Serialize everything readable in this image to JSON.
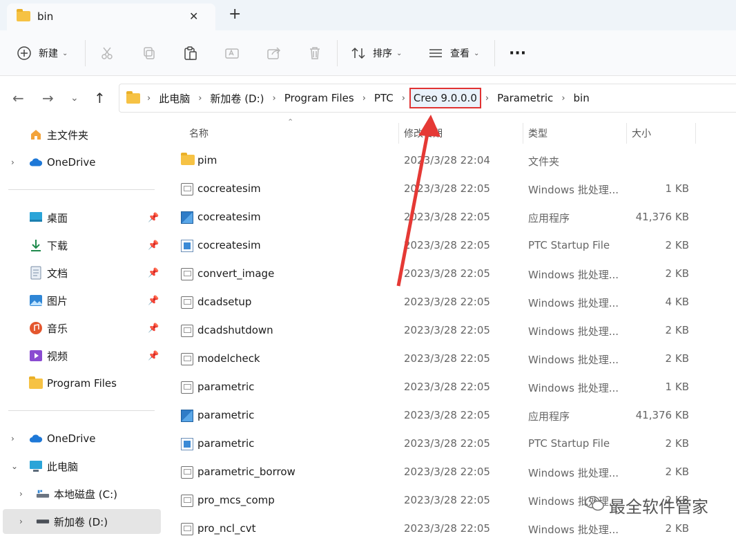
{
  "tab": {
    "title": "bin",
    "close_icon": "close-icon",
    "new_tab": "+"
  },
  "toolbar": {
    "new_label": "新建",
    "sort_label": "排序",
    "view_label": "查看",
    "more_label": "···"
  },
  "breadcrumb": [
    "此电脑",
    "新加卷 (D:)",
    "Program Files",
    "PTC",
    "Creo 9.0.0.0",
    "Parametric",
    "bin"
  ],
  "sidebar": {
    "top": [
      {
        "label": "主文件夹",
        "icon": "home-icon"
      },
      {
        "label": "OneDrive",
        "icon": "cloud-icon"
      }
    ],
    "quick": [
      {
        "label": "桌面",
        "icon": "desktop-icon"
      },
      {
        "label": "下载",
        "icon": "download-icon"
      },
      {
        "label": "文档",
        "icon": "document-icon"
      },
      {
        "label": "图片",
        "icon": "pictures-icon"
      },
      {
        "label": "音乐",
        "icon": "music-icon"
      },
      {
        "label": "视频",
        "icon": "video-icon"
      },
      {
        "label": "Program Files",
        "icon": "folder-icon"
      }
    ],
    "bottom": [
      {
        "label": "OneDrive",
        "icon": "cloud-icon"
      },
      {
        "label": "此电脑",
        "icon": "computer-icon"
      },
      {
        "label": "本地磁盘 (C:)",
        "icon": "drive-icon"
      },
      {
        "label": "新加卷 (D:)",
        "icon": "drive-icon"
      }
    ]
  },
  "columns": {
    "name": "名称",
    "date": "修改日期",
    "type": "类型",
    "size": "大小"
  },
  "files": [
    {
      "name": "pim",
      "date": "2023/3/28 22:04",
      "type": "文件夹",
      "size": "",
      "kind": "folder"
    },
    {
      "name": "cocreatesim",
      "date": "2023/3/28 22:05",
      "type": "Windows 批处理...",
      "size": "1 KB",
      "kind": "bat"
    },
    {
      "name": "cocreatesim",
      "date": "2023/3/28 22:05",
      "type": "应用程序",
      "size": "41,376 KB",
      "kind": "exe"
    },
    {
      "name": "cocreatesim",
      "date": "2023/3/28 22:05",
      "type": "PTC Startup File",
      "size": "2 KB",
      "kind": "ptc"
    },
    {
      "name": "convert_image",
      "date": "2023/3/28 22:05",
      "type": "Windows 批处理...",
      "size": "2 KB",
      "kind": "bat"
    },
    {
      "name": "dcadsetup",
      "date": "2023/3/28 22:05",
      "type": "Windows 批处理...",
      "size": "4 KB",
      "kind": "bat"
    },
    {
      "name": "dcadshutdown",
      "date": "2023/3/28 22:05",
      "type": "Windows 批处理...",
      "size": "2 KB",
      "kind": "bat"
    },
    {
      "name": "modelcheck",
      "date": "2023/3/28 22:05",
      "type": "Windows 批处理...",
      "size": "2 KB",
      "kind": "bat"
    },
    {
      "name": "parametric",
      "date": "2023/3/28 22:05",
      "type": "Windows 批处理...",
      "size": "1 KB",
      "kind": "bat"
    },
    {
      "name": "parametric",
      "date": "2023/3/28 22:05",
      "type": "应用程序",
      "size": "41,376 KB",
      "kind": "exe"
    },
    {
      "name": "parametric",
      "date": "2023/3/28 22:05",
      "type": "PTC Startup File",
      "size": "2 KB",
      "kind": "ptc"
    },
    {
      "name": "parametric_borrow",
      "date": "2023/3/28 22:05",
      "type": "Windows 批处理...",
      "size": "2 KB",
      "kind": "bat"
    },
    {
      "name": "pro_mcs_comp",
      "date": "2023/3/28 22:05",
      "type": "Windows 批处理...",
      "size": "2 KB",
      "kind": "bat"
    },
    {
      "name": "pro_ncl_cvt",
      "date": "2023/3/28 22:05",
      "type": "Windows 批处理...",
      "size": "2 KB",
      "kind": "bat"
    }
  ],
  "watermark": "最全软件管家",
  "colors": {
    "highlight_border": "#e03232",
    "arrow": "#e53935"
  }
}
